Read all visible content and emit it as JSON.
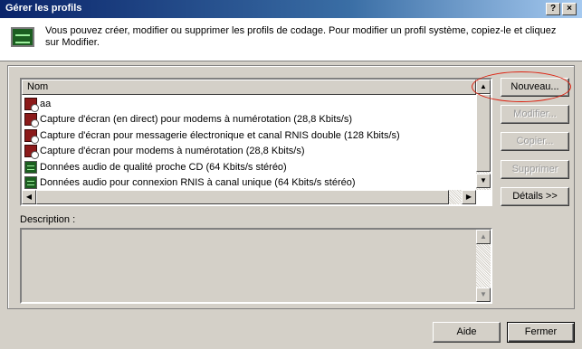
{
  "window": {
    "title": "Gérer les profils",
    "controls": {
      "help": "?",
      "close": "×"
    }
  },
  "header": {
    "icon": "codec-profile-icon",
    "text": "Vous pouvez créer, modifier ou supprimer les profils de codage. Pour modifier un profil système, copiez-le et cliquez sur Modifier."
  },
  "list": {
    "column_header": "Nom",
    "items": [
      {
        "icon": "video-profile-icon",
        "label": "aa"
      },
      {
        "icon": "video-profile-icon",
        "label": "Capture d'écran (en direct) pour modems à numérotation (28,8 Kbits/s)"
      },
      {
        "icon": "video-profile-icon",
        "label": "Capture d'écran pour messagerie électronique et canal RNIS double (128 Kbits/s)"
      },
      {
        "icon": "video-profile-icon",
        "label": "Capture d'écran pour modems à numérotation (28,8 Kbits/s)"
      },
      {
        "icon": "audio-profile-icon",
        "label": "Données audio de qualité proche CD (64 Kbits/s stéréo)"
      },
      {
        "icon": "audio-profile-icon",
        "label": "Données audio pour connexion RNIS à canal unique (64 Kbits/s stéréo)"
      }
    ]
  },
  "side_buttons": {
    "new": "Nouveau...",
    "edit": "Modifier...",
    "copy": "Copier...",
    "delete": "Supprimer",
    "details": "Détails >>"
  },
  "description": {
    "label": "Description :"
  },
  "footer": {
    "help": "Aide",
    "close": "Fermer"
  },
  "colors": {
    "title_gradient_start": "#0a246a",
    "title_gradient_end": "#a6caf0",
    "face": "#d4d0c8",
    "annotation_oval": "#d21"
  }
}
